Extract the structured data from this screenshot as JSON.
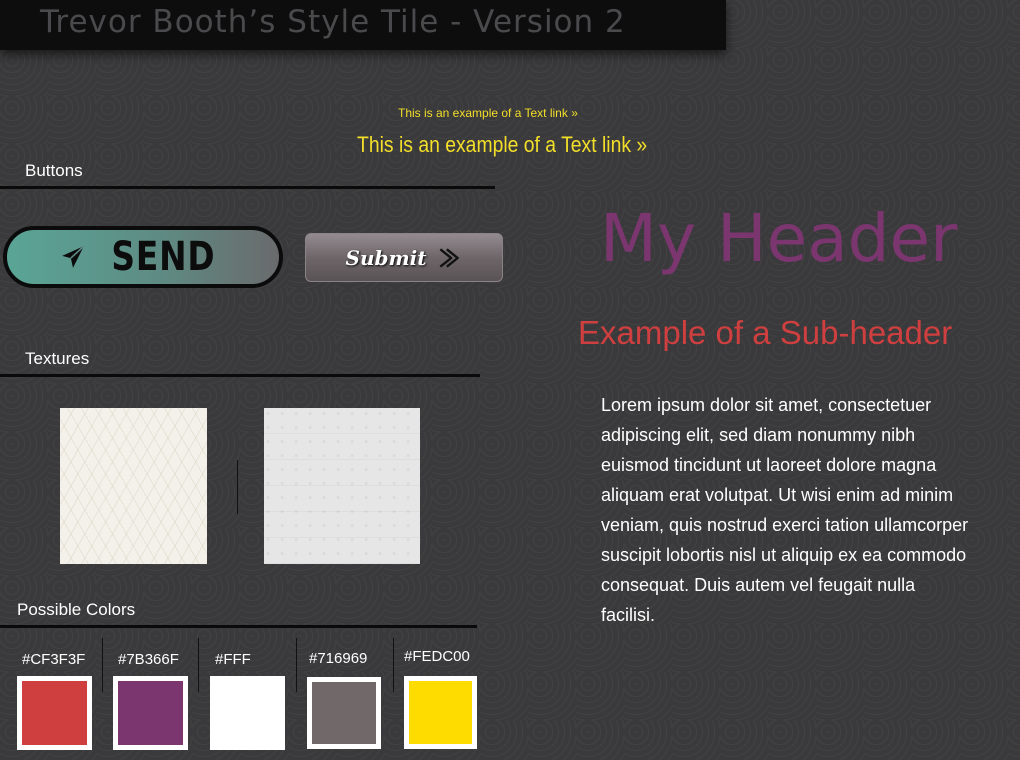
{
  "title": "Trevor Booth’s Style Tile - Version 2",
  "links": {
    "small": "This is an example of a Text link »",
    "large": "This is an example of a Text link »"
  },
  "sections": {
    "buttons": "Buttons",
    "textures": "Textures",
    "colors": "Possible Colors"
  },
  "buttons": {
    "send_label": "SEND",
    "submit_label": "Submit"
  },
  "typography": {
    "header": "My Header",
    "subheader": "Example of a Sub-header",
    "body": "Lorem ipsum dolor sit amet, consectetuer adipiscing elit, sed diam nonummy nibh euismod tincidunt ut laoreet dolore magna aliquam erat volutpat. Ut wisi enim ad minim veniam, quis nostrud exerci tation ullamcorper suscipit lobortis nisl ut aliquip ex ea commodo consequat. Duis autem vel feugait nulla facilisi."
  },
  "colors": [
    {
      "label": "#CF3F3F",
      "hex": "#CF3F3F"
    },
    {
      "label": "#7B366F",
      "hex": "#7B366F"
    },
    {
      "label": "#FFF",
      "hex": "#FFFFFF"
    },
    {
      "label": "#716969",
      "hex": "#716969"
    },
    {
      "label": "#FEDC00",
      "hex": "#FEDC00"
    }
  ]
}
